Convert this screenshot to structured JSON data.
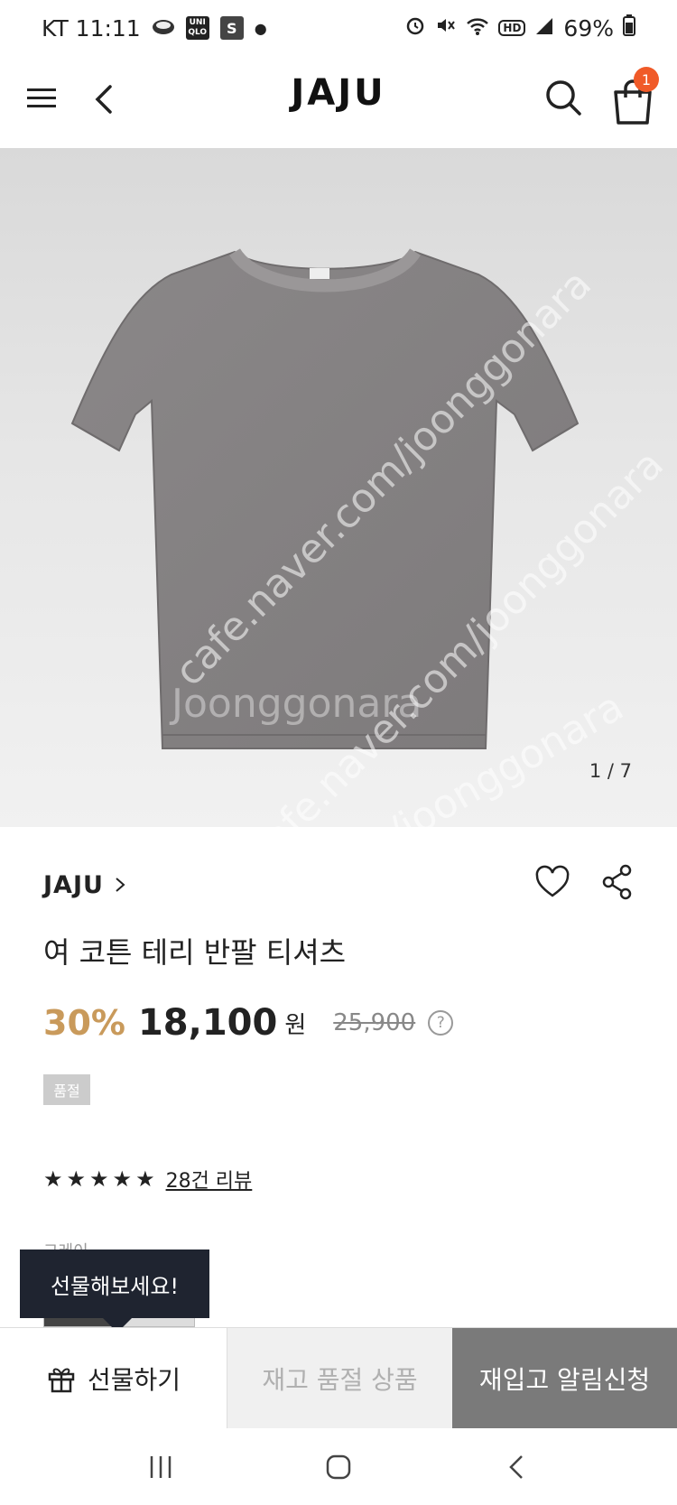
{
  "status_bar": {
    "carrier_time": "KT 11:11",
    "app_icon_uniqlo": "UNI QLO",
    "app_icon_s": "S",
    "battery": "69%",
    "icons": [
      "pill-icon",
      "uniqlo-icon",
      "s-icon",
      "dot-icon",
      "alarm-icon",
      "mute-icon",
      "wifi-icon",
      "hd-icon",
      "signal-icon",
      "battery-icon"
    ]
  },
  "header": {
    "logo": "JAJU",
    "cart_count": "1"
  },
  "hero": {
    "counter": "1 / 7",
    "watermarks": [
      "cafe.naver.com/joonggonara",
      "cafe.naver.com/joonggonara",
      "Joonggonara",
      "naver.com/joonggonara"
    ],
    "colors": {
      "shirt": "#848182",
      "background": "#e3e3e3"
    }
  },
  "product": {
    "brand": "JAJU",
    "title": "여 코튼 테리 반팔 티셔츠",
    "discount": "30%",
    "price": "18,100",
    "currency": "원",
    "original_price": "25,900",
    "help": "?",
    "soldout_badge": "품절",
    "stars": "★★★★★",
    "rating": 5,
    "review_link": "28건 리뷰",
    "color_label": "그레이"
  },
  "tooltip": {
    "text": "선물해보세요!"
  },
  "cta": {
    "gift_label": "선물하기",
    "soldout_label": "재고 품절 상품",
    "notify_label": "재입고 알림신청"
  },
  "colors": {
    "accent_discount": "#c99a5b",
    "cart_badge": "#f05a28",
    "notify_bg": "#7a7a7a",
    "tooltip_bg": "#1f2430"
  }
}
